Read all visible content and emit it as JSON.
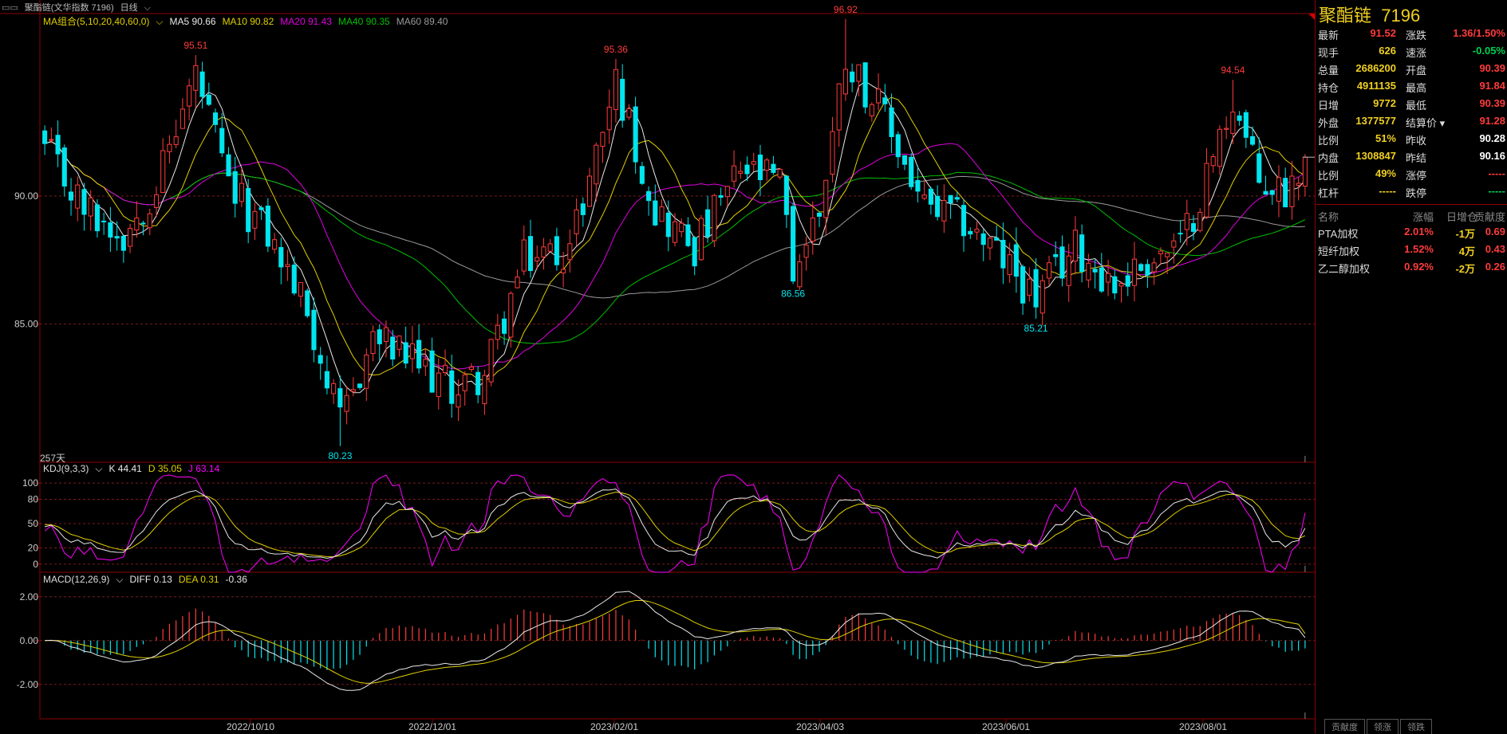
{
  "title": {
    "name": "聚酯链(文华指数 7196)",
    "period": "日线"
  },
  "main_legend": {
    "label": "MA组合(5,10,20,40,60,0)",
    "items": [
      {
        "text": "MA5 90.66",
        "color": "#e8e8e8"
      },
      {
        "text": "MA10 90.82",
        "color": "#e0d000"
      },
      {
        "text": "MA20 91.43",
        "color": "#e000e0"
      },
      {
        "text": "MA40 90.35",
        "color": "#00c000"
      },
      {
        "text": "MA60 89.40",
        "color": "#9a9a9a"
      }
    ]
  },
  "kdj_legend": {
    "label": "KDJ(9,3,3)",
    "k": "K 44.41",
    "d": "D 35.05",
    "j": "J 63.14"
  },
  "macd_legend": {
    "label": "MACD(12,26,9)",
    "diff": "DIFF 0.13",
    "dea": "DEA 0.31",
    "macd": "-0.36"
  },
  "days_label": "257天",
  "chart_data": [
    {
      "type": "candlestick",
      "panel": "price",
      "y_ticks": [
        "90.00",
        "85.00"
      ],
      "ylim": [
        79.6,
        97.1
      ],
      "x_ticks": [
        "2022/10/10",
        "2022/12/01",
        "2023/02/01",
        "2023/04/03",
        "2023/06/01",
        "2023/08/01"
      ],
      "annotations": [
        {
          "text": "95.51",
          "x_index": 23,
          "kind": "high"
        },
        {
          "text": "80.23",
          "x_index": 45,
          "kind": "low"
        },
        {
          "text": "95.36",
          "x_index": 87,
          "kind": "high"
        },
        {
          "text": "86.56",
          "x_index": 114,
          "kind": "low"
        },
        {
          "text": "96.92",
          "x_index": 122,
          "kind": "high"
        },
        {
          "text": "85.21",
          "x_index": 151,
          "kind": "low"
        },
        {
          "text": "94.54",
          "x_index": 181,
          "kind": "high"
        }
      ],
      "close_keypoints": [
        [
          0,
          91.8
        ],
        [
          6,
          89.5
        ],
        [
          12,
          88.5
        ],
        [
          17,
          90.5
        ],
        [
          23,
          94.8
        ],
        [
          28,
          90.3
        ],
        [
          34,
          88.5
        ],
        [
          40,
          85.5
        ],
        [
          45,
          81.0
        ],
        [
          50,
          84.5
        ],
        [
          56,
          83.5
        ],
        [
          62,
          82.5
        ],
        [
          67,
          83.0
        ],
        [
          73,
          87.5
        ],
        [
          80,
          88.0
        ],
        [
          87,
          94.5
        ],
        [
          93,
          89.5
        ],
        [
          99,
          88.0
        ],
        [
          106,
          91.0
        ],
        [
          112,
          90.5
        ],
        [
          114,
          87.0
        ],
        [
          118,
          89.5
        ],
        [
          122,
          95.5
        ],
        [
          128,
          93.0
        ],
        [
          134,
          89.5
        ],
        [
          140,
          89.0
        ],
        [
          146,
          87.5
        ],
        [
          151,
          86.0
        ],
        [
          157,
          88.0
        ],
        [
          163,
          86.5
        ],
        [
          168,
          87.5
        ],
        [
          173,
          88.0
        ],
        [
          178,
          91.5
        ],
        [
          181,
          93.8
        ],
        [
          185,
          90.5
        ],
        [
          189,
          90.2
        ],
        [
          192,
          91.52
        ]
      ],
      "last_close": 91.52
    },
    {
      "type": "line",
      "panel": "kdj",
      "y_ticks": [
        "100",
        "80",
        "50",
        "20",
        "0"
      ],
      "ylim": [
        -10,
        110
      ],
      "series": [
        {
          "name": "K"
        },
        {
          "name": "D"
        },
        {
          "name": "J"
        }
      ],
      "last": {
        "K": 44.41,
        "D": 35.05,
        "J": 63.14
      }
    },
    {
      "type": "bar+line",
      "panel": "macd",
      "y_ticks": [
        "2.00",
        "0.00",
        "-2.00"
      ],
      "ylim": [
        -3.5,
        2.5
      ],
      "series": [
        {
          "name": "DIFF"
        },
        {
          "name": "DEA"
        },
        {
          "name": "MACD"
        }
      ],
      "last": {
        "DIFF": 0.13,
        "DEA": 0.31,
        "MACD": -0.36
      }
    }
  ],
  "quote_panel": {
    "name": "聚酯链",
    "code": "7196",
    "rows": [
      {
        "l1": "最新",
        "v1": "91.52",
        "c1": "red",
        "l2": "涨跌",
        "v2": "1.36/1.50%",
        "c2": "red"
      },
      {
        "l1": "现手",
        "v1": "626",
        "c1": "yellow",
        "l2": "速涨",
        "v2": "-0.05%",
        "c2": "green"
      },
      {
        "l1": "总量",
        "v1": "2686200",
        "c1": "yellow",
        "l2": "开盘",
        "v2": "90.39",
        "c2": "red"
      },
      {
        "l1": "持仓",
        "v1": "4911135",
        "c1": "yellow",
        "l2": "最高",
        "v2": "91.84",
        "c2": "red"
      },
      {
        "l1": "日增",
        "v1": "9772",
        "c1": "yellow",
        "l2": "最低",
        "v2": "90.39",
        "c2": "red"
      },
      {
        "l1": "外盘",
        "v1": "1377577",
        "c1": "yellow",
        "l2": "结算价",
        "v2": "91.28",
        "c2": "red"
      },
      {
        "l1": "比例",
        "v1": "51%",
        "c1": "yellow",
        "l2": "昨收",
        "v2": "90.28",
        "c2": "white"
      },
      {
        "l1": "内盘",
        "v1": "1308847",
        "c1": "yellow",
        "l2": "昨结",
        "v2": "90.16",
        "c2": "white"
      },
      {
        "l1": "比例",
        "v1": "49%",
        "c1": "yellow",
        "l2": "涨停",
        "v2": "-----",
        "c2": "red"
      },
      {
        "l1": "杠杆",
        "v1": "-----",
        "c1": "yellow",
        "l2": "跌停",
        "v2": "-----",
        "c2": "green"
      }
    ],
    "contrib_header": {
      "name": "名称",
      "chg": "涨幅",
      "oi": "日增仓",
      "contrib": "贡献度"
    },
    "contrib_rows": [
      {
        "name": "PTA加权",
        "chg": "2.01%",
        "oi": "-1万",
        "contrib": "0.69"
      },
      {
        "name": "短纤加权",
        "chg": "1.52%",
        "oi": "4万",
        "contrib": "0.43"
      },
      {
        "name": "乙二醇加权",
        "chg": "0.92%",
        "oi": "-2万",
        "contrib": "0.26"
      }
    ],
    "tabs": [
      "贡献度",
      "领涨",
      "领跌"
    ]
  },
  "colors": {
    "up": "#ff3b3b",
    "down": "#00e5ee",
    "ma5": "#e8e8e8",
    "ma10": "#e0d000",
    "ma20": "#e000e0",
    "ma40": "#00c000",
    "ma60": "#9a9a9a",
    "grid": "#7a1a1a",
    "axis": "#8b0000"
  }
}
